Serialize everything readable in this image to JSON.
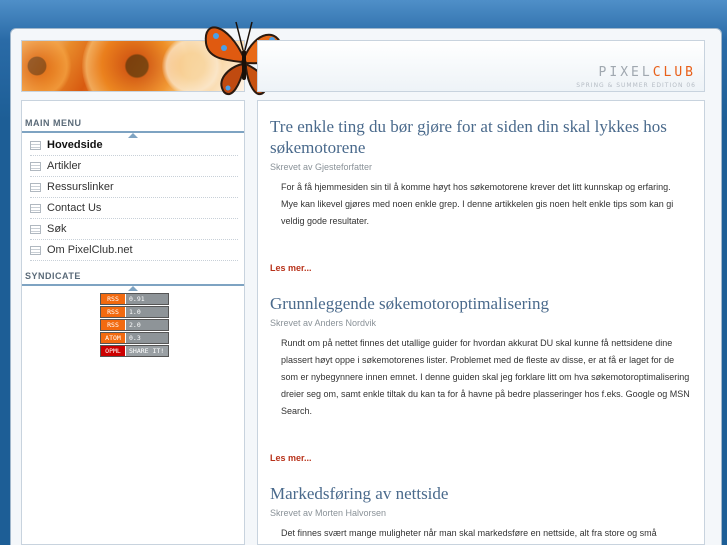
{
  "header": {
    "logo_part1": "PIXEL",
    "logo_part2": "CLUB",
    "tagline": "SPRING & SUMMER EDITION 06"
  },
  "sidebar": {
    "main_menu_title": "MAIN MENU",
    "items": [
      {
        "label": "Hovedside"
      },
      {
        "label": "Artikler"
      },
      {
        "label": "Ressurslinker"
      },
      {
        "label": "Contact Us"
      },
      {
        "label": "Søk"
      },
      {
        "label": "Om PixelClub.net"
      }
    ],
    "syndicate_title": "SYNDICATE",
    "feeds": [
      {
        "a": "RSS",
        "b": "0.91"
      },
      {
        "a": "RSS",
        "b": "1.0"
      },
      {
        "a": "RSS",
        "b": "2.0"
      },
      {
        "a": "ATOM",
        "b": "0.3"
      },
      {
        "a": "OPML",
        "b": "SHARE IT!"
      }
    ]
  },
  "articles": [
    {
      "title": "Tre enkle ting du bør gjøre for at siden din skal lykkes hos søkemotorene",
      "byline": "Skrevet av Gjesteforfatter",
      "body": "For å få hjemmesiden sin til å komme høyt hos søkemotorene krever det litt kunnskap og erfaring. Mye kan likevel gjøres med noen enkle grep. I denne artikkelen gis noen helt enkle tips som kan gi veldig gode resultater.",
      "more": "Les mer..."
    },
    {
      "title": "Grunnleggende søkemotoroptimalisering",
      "byline": "Skrevet av Anders Nordvik",
      "body": "Rundt om på nettet finnes det utallige guider for hvordan akkurat DU skal kunne få nettsidene dine plassert høyt oppe i søkemotorenes lister. Problemet med de fleste av disse, er at få er laget for de som er nybegynnere innen emnet. I denne guiden skal jeg forklare litt om hva søkemotoroptimalisering dreier seg om, samt enkle tiltak du kan ta for å havne på bedre plasseringer hos f.eks. Google og MSN Search.",
      "more": "Les mer..."
    },
    {
      "title": "Markedsføring av nettside",
      "byline": "Skrevet av Morten Halvorsen",
      "body": "Det finnes svært mange muligheter når man skal markedsføre en nettside, alt fra store og små"
    }
  ],
  "colors": {
    "background": "#1d5e96",
    "title": "#4a6a8c",
    "more_link": "#b8321a",
    "logo_accent": "#e8601a"
  }
}
